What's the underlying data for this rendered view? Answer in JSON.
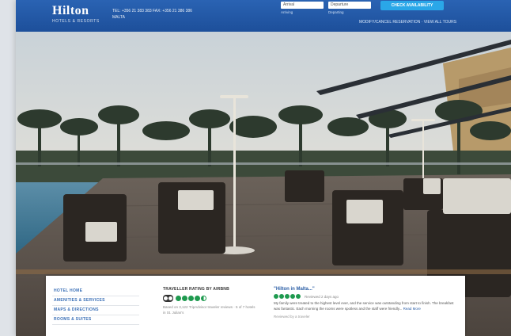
{
  "header": {
    "brand": "Hilton",
    "brand_sub": "HOTELS & RESORTS",
    "contact_line": "TEL: +356 21 383 383 FAX: +356 21 386 386",
    "contact_line2": "MALTA",
    "arrival_value": "Arrival",
    "departure_value": "Departure",
    "arrival_label": "Arriving",
    "departure_label": "Departing",
    "check_button": "CHECK AVAILABILITY",
    "links": "MODIFY/CANCEL RESERVATION · VIEW ALL TOURS"
  },
  "panel": {
    "nav": [
      "HOTEL HOME",
      "AMENITIES & SERVICES",
      "MAPS & DIRECTIONS",
      "ROOMS & SUITES"
    ],
    "tripadvisor": {
      "title": "TRAVELLER RATING BY AIRBNB",
      "rating": 4.5,
      "text": "Based on 3,122 TripAdvisor traveler reviews · 5 of 7 hotels in St. Julian's"
    },
    "review": {
      "title": "\"Hilton in Malta...\"",
      "rating": 5,
      "date": "Reviewed 2 days ago",
      "text": "My family were treated to the highest level ever, and the service was outstanding from start to finish. The breakfast was fantastic. Each morning the rooms were spotless and the staff were friendly... ",
      "more": "Read More",
      "author": "Reviewed by a traveler"
    }
  },
  "colors": {
    "header": "#1d4f9a",
    "accent": "#2aa7e8",
    "rating": "#1f9a4f"
  }
}
